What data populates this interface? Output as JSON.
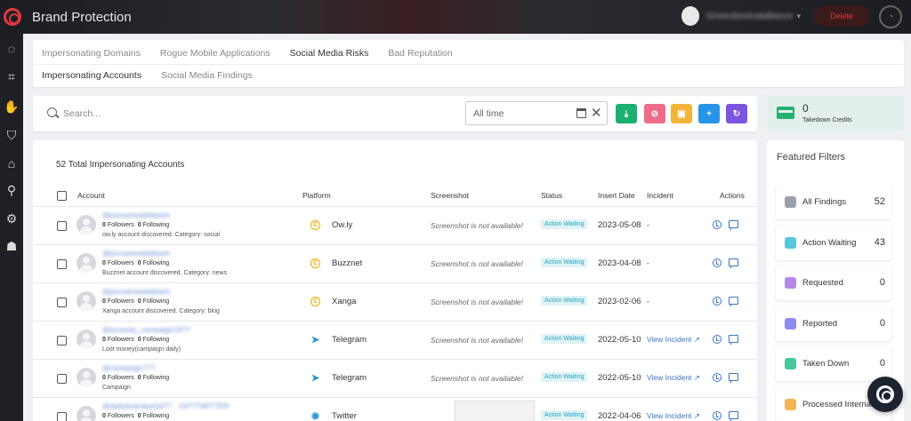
{
  "app": {
    "title": "Brand Protection"
  },
  "header": {
    "user_name": "Greendominatalliance",
    "logout_label": "Delete"
  },
  "sidebar": {
    "icons": [
      "loader-icon",
      "scan-icon",
      "hand-icon",
      "shield-icon",
      "home-shield-icon",
      "search-settings-icon",
      "gears-icon",
      "spy-icon"
    ]
  },
  "tabs": {
    "row1": [
      "Impersonating Domains",
      "Rogue Mobile Applications",
      "Social Media Risks",
      "Bad Reputation"
    ],
    "row2": [
      "Impersonating Accounts",
      "Social Media Findings"
    ]
  },
  "search": {
    "placeholder": "Search..."
  },
  "date_filter": {
    "value": "All time"
  },
  "actions": {
    "colors": [
      "#1ab06f",
      "#ef6b8a",
      "#f3b43a",
      "#2794e6",
      "#7b55e0"
    ],
    "glyphs": [
      "⤓",
      "⊘",
      "▣",
      "+",
      "↻"
    ]
  },
  "credits": {
    "value": "0",
    "label": "Takedown Credits"
  },
  "table": {
    "total_label": "52 Total Impersonating Accounts",
    "columns": {
      "account": "Account",
      "platform": "Platform",
      "screenshot": "Screenshot",
      "status": "Status",
      "insert_date": "Insert Date",
      "incident": "Incident",
      "actions": "Actions"
    },
    "rows": [
      {
        "name": "@jonnamedaldstark",
        "followers": "0",
        "following": "0",
        "desc": "ow.ly account discovered. Category: social",
        "platform": "Ow.ly",
        "platform_icon": "c",
        "screenshot": "Screenshot is not available!",
        "status": "Action Waiting",
        "date": "2023-05-08",
        "incident": "-"
      },
      {
        "name": "@jonnamedaldstark",
        "followers": "0",
        "following": "0",
        "desc": "Buzznet account discovered. Category: news",
        "platform": "Buzznet",
        "platform_icon": "c",
        "screenshot": "Screenshot is not available!",
        "status": "Action Waiting",
        "date": "2023-04-08",
        "incident": "-"
      },
      {
        "name": "@jonnamedaldstark",
        "followers": "0",
        "following": "0",
        "desc": "Xanga account discovered. Category: blog",
        "platform": "Xanga",
        "platform_icon": "c",
        "screenshot": "Screenshot is not available!",
        "status": "Action Waiting",
        "date": "2023-02-06",
        "incident": "-"
      },
      {
        "name": "@jonandy_campaign1977",
        "followers": "0",
        "following": "0",
        "desc": "Loot money(campaign daily)",
        "platform": "Telegram",
        "platform_icon": "tg",
        "screenshot": "Screenshot is not available!",
        "status": "Action Waiting",
        "date": "2022-05-10",
        "incident": "View Incident"
      },
      {
        "name": "@campaign777",
        "followers": "0",
        "following": "0",
        "desc": "Campaign",
        "platform": "Telegram",
        "platform_icon": "tg",
        "screenshot": "Screenshot is not available!",
        "status": "Action Waiting",
        "date": "2022-05-10",
        "incident": "View Incident"
      },
      {
        "name": "@dailybrandset1977 · 1977TWITTER",
        "followers": "0",
        "following": "0",
        "desc": "",
        "platform": "Twitter",
        "platform_icon": "tw",
        "screenshot": "",
        "status": "Action Waiting",
        "date": "2022-04-06",
        "incident": "View Incident"
      }
    ],
    "stat_labels": {
      "followers": "Followers",
      "following": "Following"
    }
  },
  "featured_filters": {
    "title": "Featured Filters",
    "items": [
      {
        "label": "All Findings",
        "count": "52",
        "color": "#9aa1ab"
      },
      {
        "label": "Action Waiting",
        "count": "43",
        "color": "#56c6dc"
      },
      {
        "label": "Requested",
        "count": "0",
        "color": "#b48ae8"
      },
      {
        "label": "Reported",
        "count": "0",
        "color": "#8d8cf0"
      },
      {
        "label": "Taken Down",
        "count": "0",
        "color": "#47c79a"
      },
      {
        "label": "Processed Internally",
        "count": "",
        "color": "#f2b556"
      }
    ]
  }
}
